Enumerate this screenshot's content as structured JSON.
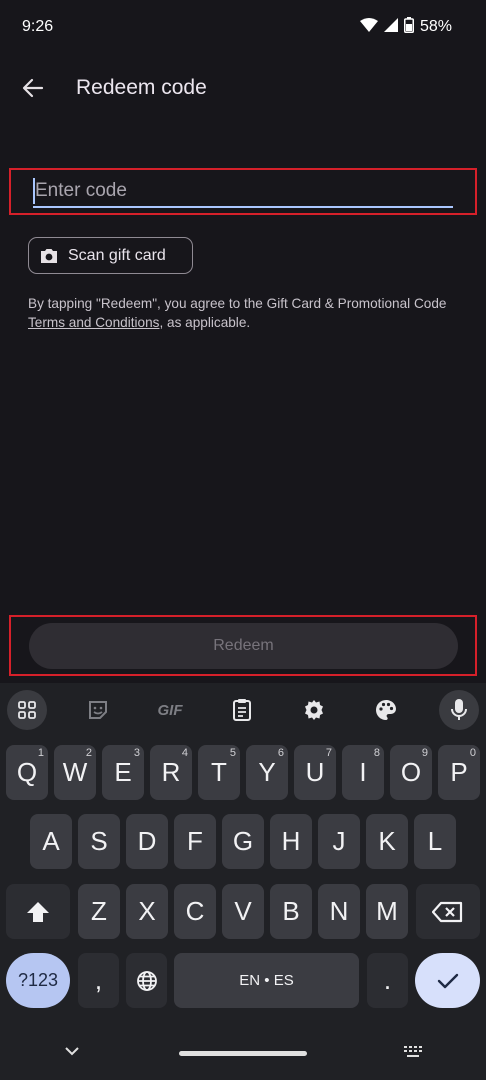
{
  "status": {
    "time": "9:26",
    "battery": "58%"
  },
  "app_bar": {
    "title": "Redeem code"
  },
  "code_field": {
    "placeholder": "Enter code",
    "value": ""
  },
  "scan_button": {
    "label": "Scan gift card"
  },
  "terms": {
    "before": "By tapping \"Redeem\", you agree to the Gift Card & Promotional Code ",
    "link": "Terms and Conditions",
    "after": ", as applicable."
  },
  "redeem_button": {
    "label": "Redeem"
  },
  "keyboard": {
    "toolbar": [
      "apps-grid-icon",
      "sticker-icon",
      "gif-icon",
      "clipboard-icon",
      "settings-gear-icon",
      "palette-icon",
      "microphone-icon"
    ],
    "gif_label": "GIF",
    "row1": [
      {
        "k": "Q",
        "h": "1"
      },
      {
        "k": "W",
        "h": "2"
      },
      {
        "k": "E",
        "h": "3"
      },
      {
        "k": "R",
        "h": "4"
      },
      {
        "k": "T",
        "h": "5"
      },
      {
        "k": "Y",
        "h": "6"
      },
      {
        "k": "U",
        "h": "7"
      },
      {
        "k": "I",
        "h": "8"
      },
      {
        "k": "O",
        "h": "9"
      },
      {
        "k": "P",
        "h": "0"
      }
    ],
    "row2": [
      "A",
      "S",
      "D",
      "F",
      "G",
      "H",
      "J",
      "K",
      "L"
    ],
    "row3": [
      "Z",
      "X",
      "C",
      "V",
      "B",
      "N",
      "M"
    ],
    "symbols_label": "?123",
    "comma_label": ",",
    "space_label": "EN • ES",
    "period_label": "."
  }
}
